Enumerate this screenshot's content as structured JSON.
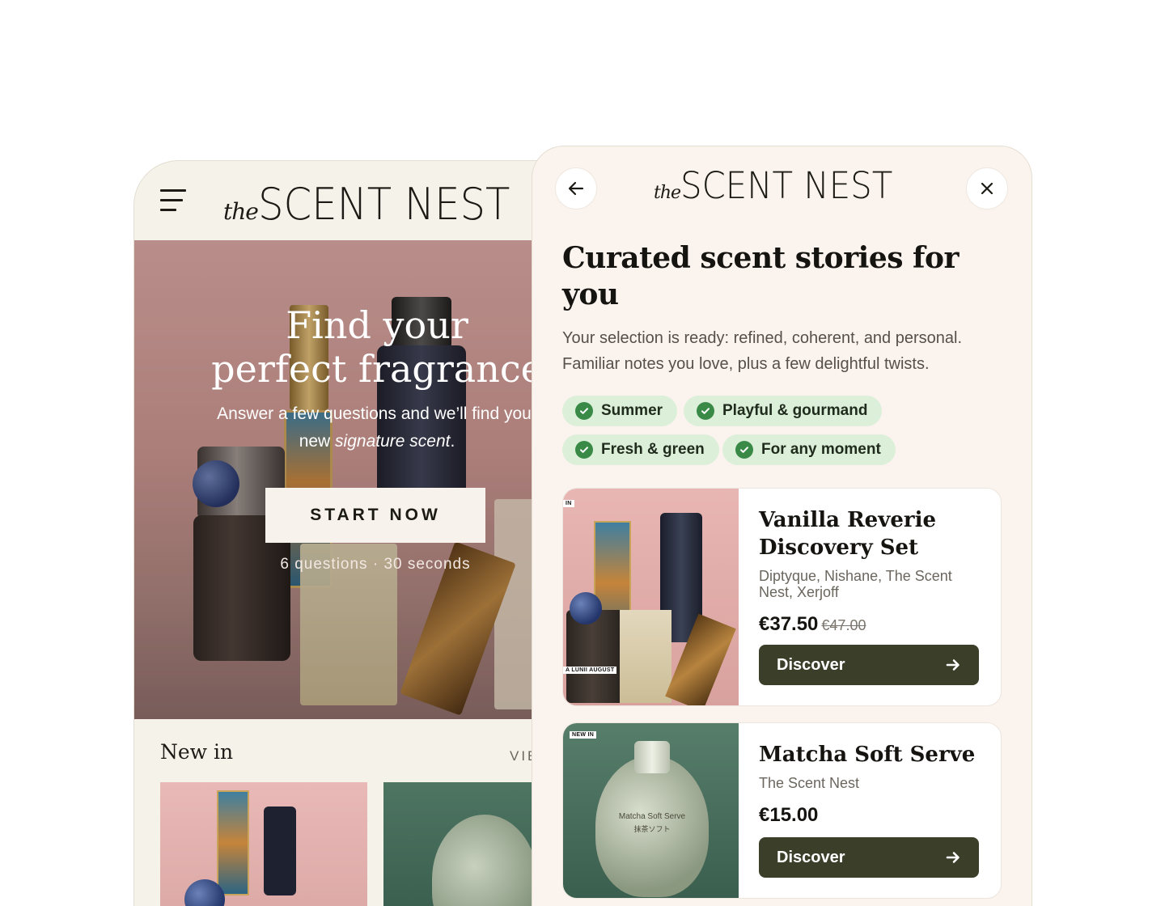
{
  "brand": {
    "prefix": "the",
    "name": "SCENT NEST"
  },
  "home": {
    "menu_icon": "hamburger-menu-icon",
    "hero": {
      "title_line1": "Find your",
      "title_line2": "perfect fragrance",
      "subtitle_prefix": "Answer a few questions and we’ll find your",
      "subtitle_new": "new ",
      "subtitle_emph": "signature scent",
      "subtitle_end": ".",
      "cta": "START NOW",
      "meta": "6 questions · 30 seconds"
    },
    "new_in": {
      "title": "New in",
      "view_all": "VIEW ALL"
    }
  },
  "modal": {
    "back_icon": "arrow-left-icon",
    "close_icon": "close-icon",
    "title": "Curated scent stories for you",
    "description": "Your selection is ready: refined, coherent, and personal. Familiar notes you love, plus a few delightful twists.",
    "chips": [
      "Summer",
      "Playful & gourmand",
      "Fresh & green",
      "For any moment"
    ],
    "products": [
      {
        "name": "Vanilla Reverie Discovery Set",
        "brands": "Diptyque, Nishane, The Scent Nest, Xerjoff",
        "price": "€37.50",
        "old_price": "€47.00",
        "tag_top": "IN",
        "tag_bottom": "A LUNII AUGUST",
        "cta": "Discover"
      },
      {
        "name": "Matcha Soft Serve",
        "brands": "The Scent Nest",
        "price": "€15.00",
        "old_price": "",
        "tag_top": "NEW IN",
        "bottle_label": "Matcha Soft Serve",
        "bottle_sub": "抹茶ソフト",
        "cta": "Discover"
      }
    ]
  },
  "colors": {
    "cream": "#f5f2ea",
    "modal_bg": "#faf3ee",
    "chip_bg": "#dcefd8",
    "check_green": "#3a8a47",
    "button_dark": "#3b3f2a"
  }
}
